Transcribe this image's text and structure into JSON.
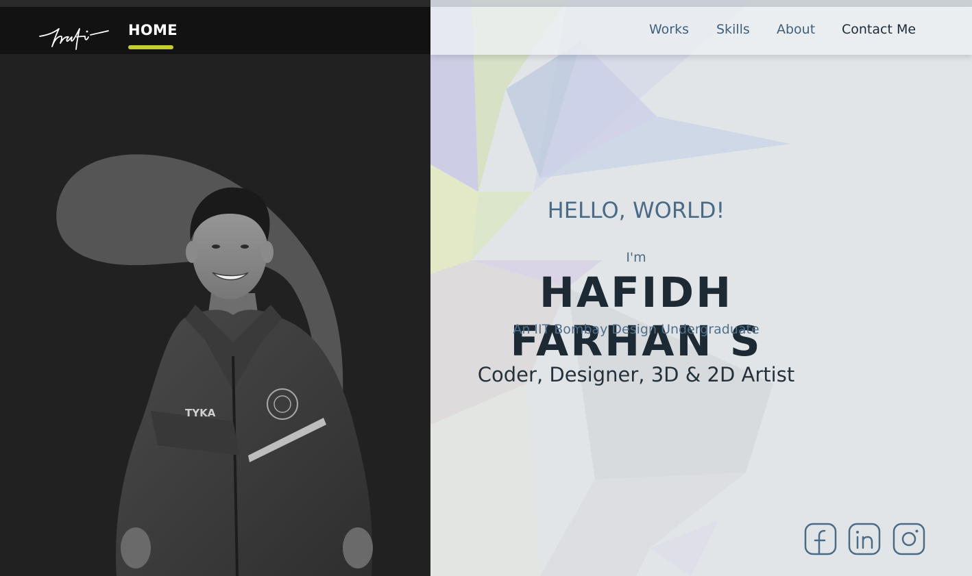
{
  "header": {
    "logo_text": "hafi",
    "home_label": "HOME"
  },
  "nav": {
    "items": [
      {
        "label": "Works"
      },
      {
        "label": "Skills"
      },
      {
        "label": "About"
      },
      {
        "label": "Contact Me"
      }
    ]
  },
  "hero": {
    "greeting": "HELLO, WORLD!",
    "intro": "I'm",
    "name": "HAFIDH FARHAN S",
    "subtitle": "An IIT Bombay Design Undergraduate",
    "roles": "Coder, Designer, 3D & 2D Artist"
  },
  "portrait": {
    "jacket_brand": "TYKA"
  },
  "social": {
    "items": [
      {
        "icon": "facebook-icon"
      },
      {
        "icon": "linkedin-icon"
      },
      {
        "icon": "instagram-icon"
      }
    ]
  },
  "colors": {
    "accent": "#c3cf2e",
    "left_bg": "#212121",
    "header_bg": "#121212",
    "right_bg": "#dfe3e6",
    "name_color": "#1d2a33",
    "nav_color": "#3f5f7c",
    "icon_color": "#4a6a86"
  }
}
